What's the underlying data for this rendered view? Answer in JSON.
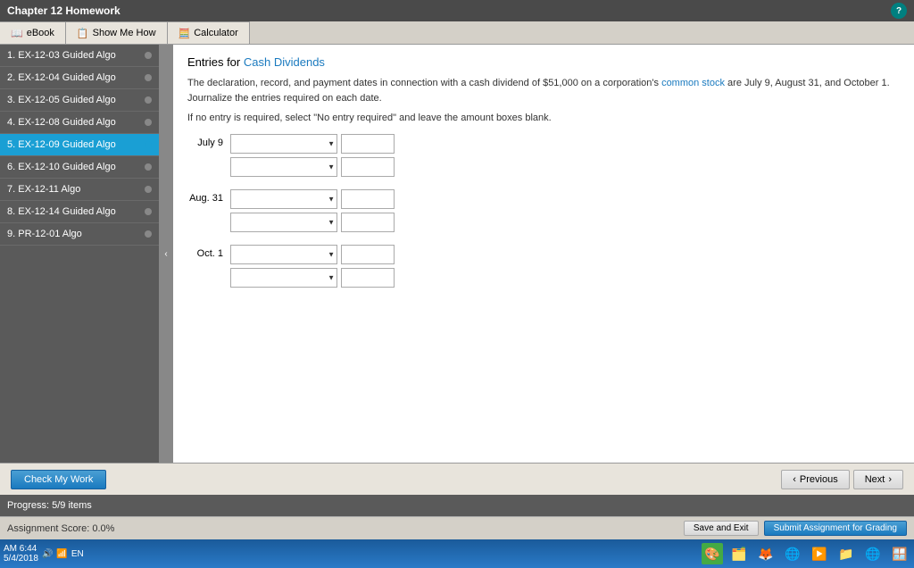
{
  "titleBar": {
    "title": "Chapter 12 Homework",
    "icon": "📚"
  },
  "tabs": [
    {
      "id": "ebook",
      "label": "eBook",
      "icon": "📖",
      "active": false
    },
    {
      "id": "show-me-how",
      "label": "Show Me How",
      "icon": "📋",
      "active": false
    },
    {
      "id": "calculator",
      "label": "Calculator",
      "icon": "🧮",
      "active": false
    }
  ],
  "sidebar": {
    "items": [
      {
        "id": 1,
        "label": "1. EX-12-03 Guided Algo",
        "active": false
      },
      {
        "id": 2,
        "label": "2. EX-12-04 Guided Algo",
        "active": false
      },
      {
        "id": 3,
        "label": "3. EX-12-05 Guided Algo",
        "active": false
      },
      {
        "id": 4,
        "label": "4. EX-12-08 Guided Algo",
        "active": false
      },
      {
        "id": 5,
        "label": "5. EX-12-09 Guided Algo",
        "active": true
      },
      {
        "id": 6,
        "label": "6. EX-12-10 Guided Algo",
        "active": false
      },
      {
        "id": 7,
        "label": "7. EX-12-11 Algo",
        "active": false
      },
      {
        "id": 8,
        "label": "8. EX-12-14 Guided Algo",
        "active": false
      },
      {
        "id": 9,
        "label": "9. PR-12-01 Algo",
        "active": false
      }
    ],
    "progress": "Progress: 5/9 items"
  },
  "content": {
    "entriesFor": "Entries for",
    "cashDividends": "Cash Dividends",
    "description": "The declaration, record, and payment dates in connection with a cash dividend of $51,000 on a corporation's",
    "commonStock": "common stock",
    "descriptionEnd": "are July 9, August 31, and October 1. Journalize the entries required on each date.",
    "noEntryNote": "If no entry is required, select \"No entry required\" and leave the amount boxes blank.",
    "dates": [
      {
        "label": "July 9",
        "rows": 2
      },
      {
        "label": "Aug. 31",
        "rows": 2
      },
      {
        "label": "Oct. 1",
        "rows": 2
      }
    ]
  },
  "buttons": {
    "checkMyWork": "Check My Work",
    "previous": "Previous",
    "next": "Next",
    "saveAndExit": "Save and Exit",
    "submitForGrading": "Submit Assignment for Grading"
  },
  "statusBar": {
    "assignmentScore": "Assignment Score: 0.0%"
  },
  "taskbar": {
    "time": "AM 6:44",
    "date": "5/4/2018",
    "language": "EN"
  },
  "collapseIcon": "‹"
}
